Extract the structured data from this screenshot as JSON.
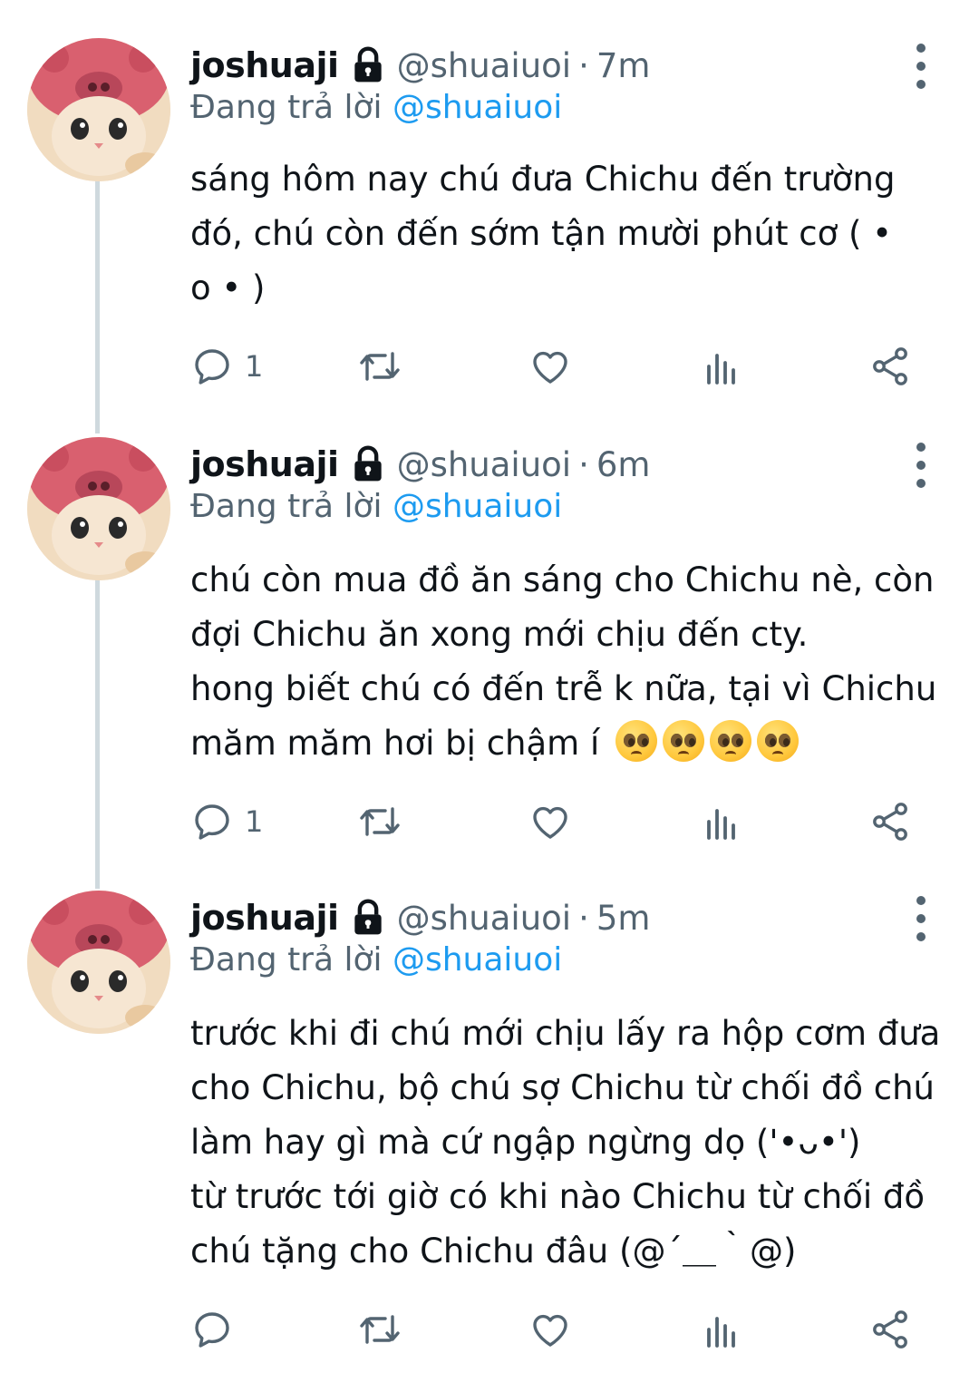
{
  "tweets": [
    {
      "name": "joshuaji",
      "handle": "@shuaiuoi",
      "separator": "·",
      "time": "7m",
      "replying_prefix": "Đang trả lời ",
      "replying_to": "@shuaiuoi",
      "lines": [
        "sáng hôm nay chú đưa Chichu đến trường",
        "đó, chú còn đến sớm tận mười phút cơ ( •",
        "o • )"
      ],
      "reply_count": "1",
      "pleading_emojis": 0
    },
    {
      "name": "joshuaji",
      "handle": "@shuaiuoi",
      "separator": "·",
      "time": "6m",
      "replying_prefix": "Đang trả lời ",
      "replying_to": "@shuaiuoi",
      "lines": [
        "chú còn mua đồ ăn sáng cho Chichu nè, còn",
        "đợi Chichu ăn xong mới chịu đến cty.",
        "hong biết chú có đến trễ k nữa, tại vì Chichu",
        "măm măm hơi bị chậm í"
      ],
      "reply_count": "1",
      "pleading_emojis": 4
    },
    {
      "name": "joshuaji",
      "handle": "@shuaiuoi",
      "separator": "·",
      "time": "5m",
      "replying_prefix": "Đang trả lời ",
      "replying_to": "@shuaiuoi",
      "lines": [
        "trước khi đi chú mới chịu lấy ra hộp cơm đưa",
        "cho Chichu, bộ chú sợ Chichu từ chối đồ chú",
        "làm hay gì mà cứ ngập ngừng dọ ('•ᴗ•')",
        "từ trước tới giờ có khi nào Chichu từ chối đồ",
        "chú tặng cho Chichu đâu (@´＿｀@)"
      ],
      "reply_count": "",
      "pleading_emojis": 0
    }
  ],
  "icons": {
    "lock": "lock-icon",
    "more": "more-vertical-icon",
    "reply": "reply-icon",
    "retweet": "retweet-icon",
    "like": "heart-icon",
    "views": "analytics-icon",
    "share": "share-icon"
  },
  "colors": {
    "text": "#0f1419",
    "secondary": "#536471",
    "link": "#1d9bf0",
    "thread_line": "#cfd9de"
  }
}
